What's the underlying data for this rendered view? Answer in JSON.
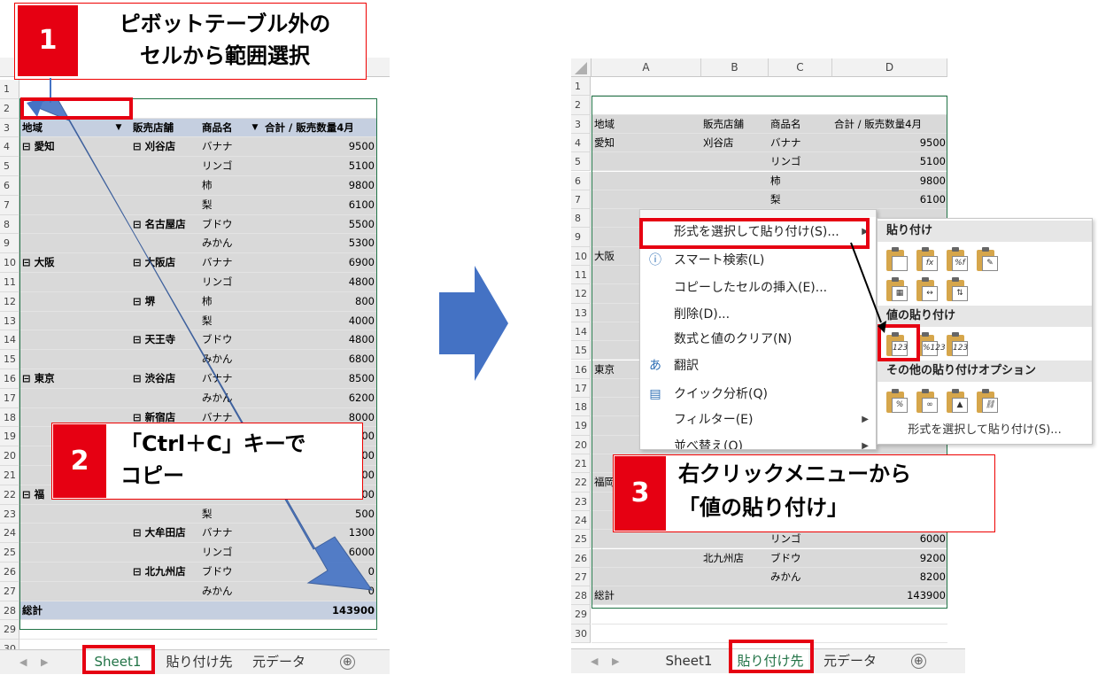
{
  "steps": {
    "step1": {
      "number": "1",
      "line1": "ピボットテーブル外の",
      "line2": "セルから範囲選択"
    },
    "step2": {
      "number": "2",
      "line1": "「Ctrl＋C」キーで",
      "line2": "コピー"
    },
    "step3": {
      "number": "3",
      "line1": "右クリックメニューから",
      "line2": "「値の貼り付け」"
    }
  },
  "left_sheet": {
    "row_numbers": [
      "1",
      "2",
      "3",
      "4",
      "5",
      "6",
      "7",
      "8",
      "9",
      "10",
      "11",
      "12",
      "13",
      "14",
      "15",
      "16",
      "17",
      "18",
      "19",
      "20",
      "21",
      "22",
      "23",
      "24",
      "25",
      "26",
      "27",
      "28",
      "29",
      "30"
    ],
    "headers": {
      "region": "地域",
      "store": "販売店舗",
      "product": "商品名",
      "total": "合計 / 販売数量4月"
    },
    "rows": [
      {
        "region": "⊟ 愛知",
        "store": "⊟ 刈谷店",
        "product": "バナナ",
        "value": "9500"
      },
      {
        "region": "",
        "store": "",
        "product": "リンゴ",
        "value": "5100"
      },
      {
        "region": "",
        "store": "",
        "product": "柿",
        "value": "9800"
      },
      {
        "region": "",
        "store": "",
        "product": "梨",
        "value": "6100"
      },
      {
        "region": "",
        "store": "⊟ 名古屋店",
        "product": "ブドウ",
        "value": "5500"
      },
      {
        "region": "",
        "store": "",
        "product": "みかん",
        "value": "5300"
      },
      {
        "region": "⊟ 大阪",
        "store": "⊟ 大阪店",
        "product": "バナナ",
        "value": "6900"
      },
      {
        "region": "",
        "store": "",
        "product": "リンゴ",
        "value": "4800"
      },
      {
        "region": "",
        "store": "⊟ 堺",
        "product": "柿",
        "value": "800"
      },
      {
        "region": "",
        "store": "",
        "product": "梨",
        "value": "4000"
      },
      {
        "region": "",
        "store": "⊟ 天王寺",
        "product": "ブドウ",
        "value": "4800"
      },
      {
        "region": "",
        "store": "",
        "product": "みかん",
        "value": "6800"
      },
      {
        "region": "⊟ 東京",
        "store": "⊟ 渋谷店",
        "product": "バナナ",
        "value": "8500"
      },
      {
        "region": "",
        "store": "",
        "product": "みかん",
        "value": "6200"
      },
      {
        "region": "",
        "store": "⊟ 新宿店",
        "product": "バナナ",
        "value": "8000"
      },
      {
        "region": "",
        "store": "",
        "product": "",
        "value": "00"
      },
      {
        "region": "",
        "store": "",
        "product": "",
        "value": "00"
      },
      {
        "region": "",
        "store": "",
        "product": "",
        "value": "00"
      },
      {
        "region": "⊟ 福",
        "store": "",
        "product": "",
        "value": "00"
      },
      {
        "region": "",
        "store": "",
        "product": "梨",
        "value": "500"
      },
      {
        "region": "",
        "store": "⊟ 大牟田店",
        "product": "バナナ",
        "value": "1300"
      },
      {
        "region": "",
        "store": "",
        "product": "リンゴ",
        "value": "6000"
      },
      {
        "region": "",
        "store": "⊟ 北九州店",
        "product": "ブドウ",
        "value": "0"
      },
      {
        "region": "",
        "store": "",
        "product": "みかん",
        "value": "0"
      }
    ],
    "total_label": "総計",
    "total_value": "143900",
    "tabs": [
      "Sheet1",
      "貼り付け先",
      "元データ"
    ],
    "plus": "⊕"
  },
  "right_sheet": {
    "columns": [
      "A",
      "B",
      "C",
      "D"
    ],
    "row_numbers": [
      "1",
      "2",
      "3",
      "4",
      "5",
      "6",
      "7",
      "8",
      "9",
      "10",
      "11",
      "12",
      "13",
      "14",
      "15",
      "16",
      "17",
      "18",
      "19",
      "20",
      "21",
      "22",
      "23",
      "24",
      "25",
      "26",
      "27",
      "28",
      "29",
      "30"
    ],
    "headers": {
      "region": "地域",
      "store": "販売店舗",
      "product": "商品名",
      "total": "合計 / 販売数量4月"
    },
    "rows": [
      {
        "a": "愛知",
        "b": "刈谷店",
        "c": "バナナ",
        "d": "9500"
      },
      {
        "a": "",
        "b": "",
        "c": "リンゴ",
        "d": "5100"
      },
      {
        "a": "",
        "b": "",
        "c": "柿",
        "d": "9800"
      },
      {
        "a": "",
        "b": "",
        "c": "梨",
        "d": "6100"
      }
    ],
    "side_labels": {
      "r10": "大阪",
      "r16": "東京",
      "r22": "福岡"
    },
    "lower_rows": [
      {
        "a": "",
        "b": "",
        "c": "リンゴ",
        "d": "6000"
      },
      {
        "a": "",
        "b": "北九州店",
        "c": "ブドウ",
        "d": "9200"
      },
      {
        "a": "",
        "b": "",
        "c": "みかん",
        "d": "8200"
      }
    ],
    "total_label": "総計",
    "total_value": "143900",
    "tabs": [
      "Sheet1",
      "貼り付け先",
      "元データ"
    ],
    "plus": "⊕"
  },
  "context_menu": {
    "items": [
      {
        "label": "形式を選択して貼り付け(S)...",
        "icon": ""
      },
      {
        "label": "スマート検索(L)",
        "icon": "ⓘ"
      },
      {
        "label": "コピーしたセルの挿入(E)...",
        "icon": ""
      },
      {
        "label": "削除(D)...",
        "icon": ""
      },
      {
        "label": "数式と値のクリア(N)",
        "icon": ""
      },
      {
        "label": "翻訳",
        "icon": "あ"
      },
      {
        "label": "クイック分析(Q)",
        "icon": "▤"
      },
      {
        "label": "フィルター(E)",
        "icon": ""
      },
      {
        "label": "並べ替え(O)",
        "icon": ""
      }
    ]
  },
  "paste_submenu": {
    "section1": "貼り付け",
    "section2": "値の貼り付け",
    "section3": "その他の貼り付けオプション",
    "values_icons": [
      "123",
      "%123",
      "123"
    ],
    "more": "形式を選択して貼り付け(S)..."
  },
  "colors": {
    "accent_red": "#e60012",
    "excel_green": "#217346",
    "arrow_blue": "#4472c4"
  }
}
